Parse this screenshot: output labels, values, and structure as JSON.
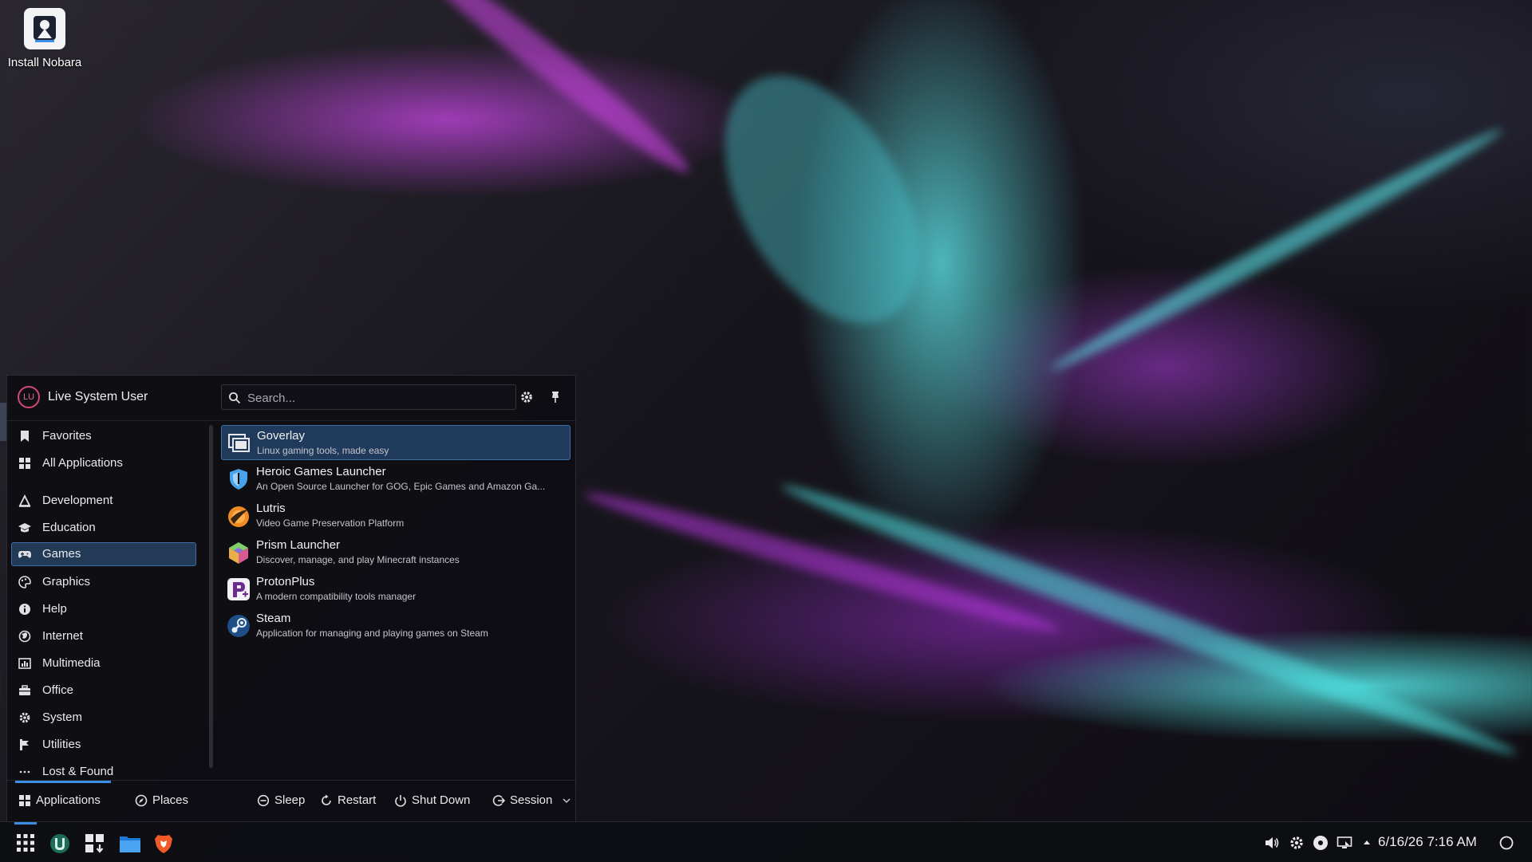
{
  "desktop": {
    "icons": [
      {
        "label": "Install Nobara",
        "icon": "installer-icon"
      }
    ]
  },
  "launcher": {
    "user": {
      "initials": "LU",
      "name": "Live System User"
    },
    "search": {
      "placeholder": "Search...",
      "value": ""
    },
    "categories": [
      {
        "label": "Favorites",
        "icon": "bookmark-icon"
      },
      {
        "label": "All Applications",
        "icon": "grid-icon"
      },
      {
        "label": "Development",
        "icon": "development-icon"
      },
      {
        "label": "Education",
        "icon": "graduation-cap-icon"
      },
      {
        "label": "Games",
        "icon": "gamepad-icon",
        "selected": true
      },
      {
        "label": "Graphics",
        "icon": "palette-icon"
      },
      {
        "label": "Help",
        "icon": "info-icon"
      },
      {
        "label": "Internet",
        "icon": "globe-icon"
      },
      {
        "label": "Multimedia",
        "icon": "multimedia-icon"
      },
      {
        "label": "Office",
        "icon": "briefcase-icon"
      },
      {
        "label": "System",
        "icon": "gear-icon"
      },
      {
        "label": "Utilities",
        "icon": "utilities-icon"
      },
      {
        "label": "Lost & Found",
        "icon": "ellipsis-icon"
      }
    ],
    "apps": [
      {
        "name": "Goverlay",
        "description": "Linux gaming tools, made easy",
        "icon": "goverlay-icon",
        "selected": true
      },
      {
        "name": "Heroic Games Launcher",
        "description": "An Open Source Launcher for GOG, Epic Games and Amazon Ga...",
        "icon": "heroic-shield-icon"
      },
      {
        "name": "Lutris",
        "description": "Video Game Preservation Platform",
        "icon": "lutris-icon"
      },
      {
        "name": "Prism Launcher",
        "description": "Discover, manage, and play Minecraft instances",
        "icon": "prism-cube-icon"
      },
      {
        "name": "ProtonPlus",
        "description": "A modern compatibility tools manager",
        "icon": "protonplus-icon"
      },
      {
        "name": "Steam",
        "description": "Application for managing and playing games on Steam",
        "icon": "steam-icon"
      }
    ],
    "footer": {
      "tabs": [
        {
          "label": "Applications",
          "icon": "grid-icon",
          "selected": true
        },
        {
          "label": "Places",
          "icon": "compass-icon"
        }
      ],
      "power": [
        {
          "label": "Sleep",
          "icon": "sleep-icon"
        },
        {
          "label": "Restart",
          "icon": "restart-icon"
        },
        {
          "label": "Shut Down",
          "icon": "power-icon"
        },
        {
          "label": "Session",
          "icon": "session-icon"
        }
      ]
    }
  },
  "taskbar": {
    "items": [
      "app-launcher-icon",
      "nobara-icon",
      "software-center-icon",
      "file-manager-icon",
      "brave-browser-icon"
    ],
    "tray": [
      "volume-icon",
      "settings-icon",
      "disc-icon",
      "display-icon",
      "expand-arrow-icon"
    ],
    "clock": "6/16/26 7:16 AM"
  },
  "colors": {
    "accent": "#3d8ee6",
    "selection": "#223a56",
    "panel": "#0e0e13"
  }
}
